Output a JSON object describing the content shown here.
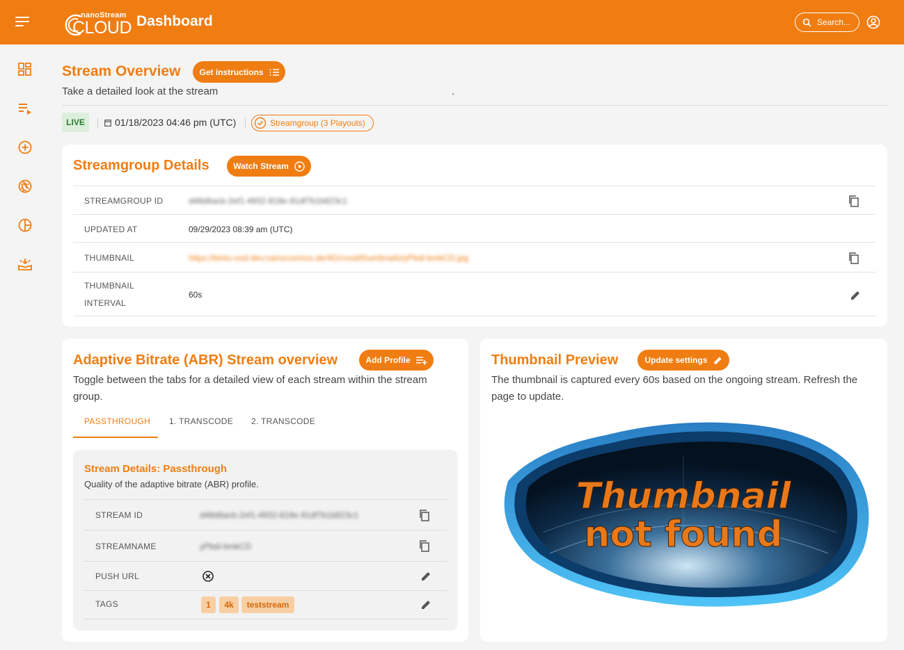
{
  "header": {
    "logo_small": "nanoStream",
    "logo_big": "CLOUD",
    "title": "Dashboard",
    "search_label": "Search..."
  },
  "sidebar": {
    "items": [
      {
        "icon": "dashboard-icon"
      },
      {
        "icon": "playlist-play-icon"
      },
      {
        "icon": "add-circle-icon"
      },
      {
        "icon": "shutter-icon"
      },
      {
        "icon": "pie-chart-icon"
      },
      {
        "icon": "inbox-download-icon"
      }
    ]
  },
  "overview": {
    "title": "Stream Overview",
    "instructions_button": "Get instructions",
    "subtitle": "Take a detailed look at the stream",
    "subtitle_end": ".",
    "live_badge": "LIVE",
    "date": "01/18/2023 04:46 pm (UTC)",
    "streamgroup_chip": "Streamgroup (3 Playouts)"
  },
  "streamgroup": {
    "title": "Streamgroup Details",
    "watch_button": "Watch Stream",
    "rows": [
      {
        "key": "STREAMGROUP ID",
        "value": "d48d6acb-2ef1-4932-818e-91df7b1b823c1"
      },
      {
        "key": "UPDATED AT",
        "value": "09/29/2023 08:39 am (UTC)"
      },
      {
        "key": "THUMBNAIL",
        "value": "https://bintu-vod-dev.nanocosmos.de/4G/cvod/thumbnails/yPbdi-bmkCD.jpg"
      },
      {
        "key_line1": "THUMBNAIL",
        "key_line2": "INTERVAL",
        "value": "60s"
      }
    ]
  },
  "abr": {
    "title": "Adaptive Bitrate (ABR) Stream overview",
    "add_profile_button": "Add Profile",
    "description": "Toggle between the tabs for a detailed view of each stream within the stream group.",
    "tabs": [
      {
        "label": "PASSTHROUGH",
        "active": true
      },
      {
        "label": "1. TRANSCODE",
        "active": false
      },
      {
        "label": "2. TRANSCODE",
        "active": false
      }
    ],
    "details": {
      "title": "Stream Details: Passthrough",
      "subtitle": "Quality of the adaptive bitrate (ABR) profile.",
      "rows": [
        {
          "key": "STREAM ID",
          "value": "d48d6acb-2ef1-4932-818e-91df7b1b823c1"
        },
        {
          "key": "STREAMNAME",
          "value": "yPbdi-bmkCD"
        },
        {
          "key": "PUSH URL"
        },
        {
          "key": "TAGS"
        }
      ],
      "tags": [
        "1",
        "4k",
        "teststream"
      ]
    }
  },
  "thumbnail": {
    "title": "Thumbnail Preview",
    "update_button": "Update settings",
    "description": "The thumbnail is captured every 60s based on the ongoing stream. Refresh the page to update.",
    "image_line1": "Thumbnail",
    "image_line2": "not found"
  },
  "colors": {
    "accent": "#ef7d12",
    "live_bg": "#dcefdc",
    "live_text": "#2e7d32",
    "tag_bg": "#f8cfa3"
  }
}
